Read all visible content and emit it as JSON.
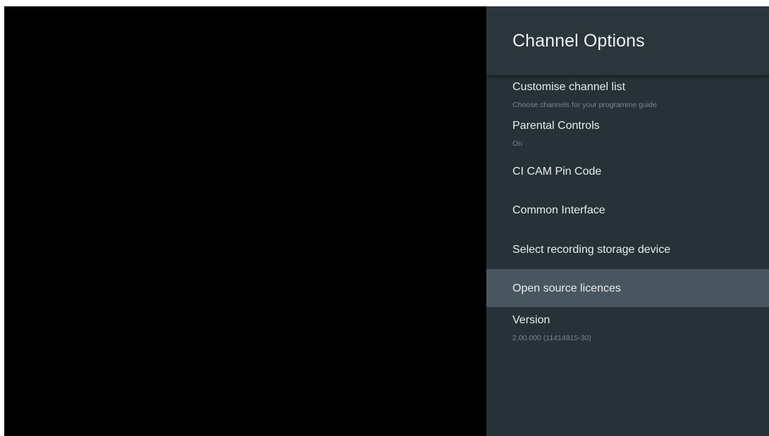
{
  "panel": {
    "title": "Channel Options",
    "items": [
      {
        "label": "Customise channel list",
        "subtitle": "Choose channels for your programme guide"
      },
      {
        "label": "Parental Controls",
        "subtitle": "On"
      },
      {
        "label": "CI CAM Pin Code"
      },
      {
        "label": "Common Interface"
      },
      {
        "label": "Select recording storage device"
      },
      {
        "label": "Open source licences",
        "selected": true
      },
      {
        "label": "Version",
        "subtitle": "2.00.000 (11414815-30)"
      }
    ]
  },
  "colors": {
    "panel_background": "#263238",
    "header_background": "#2b363c",
    "selected_background": "#48575f",
    "primary_text": "#e8ecee",
    "secondary_text": "#7b878d",
    "video_area": "#000000"
  }
}
